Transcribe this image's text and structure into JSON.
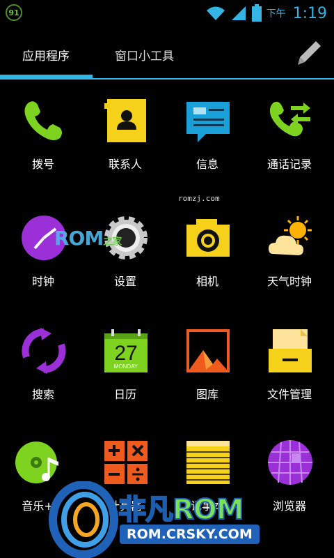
{
  "status_bar": {
    "badge": "91",
    "ampm": "下午",
    "time": "1:19",
    "icons": [
      "wifi-icon",
      "signal-icon",
      "battery-icon"
    ]
  },
  "tabs": {
    "apps": "应用程序",
    "widgets": "窗口小工具",
    "pencil_icon": "pencil-icon"
  },
  "apps": [
    {
      "label": "拨号",
      "icon": "phone-icon"
    },
    {
      "label": "联系人",
      "icon": "contacts-icon"
    },
    {
      "label": "信息",
      "icon": "message-icon"
    },
    {
      "label": "通话记录",
      "icon": "call-log-icon"
    },
    {
      "label": "时钟",
      "icon": "clock-icon"
    },
    {
      "label": "设置",
      "icon": "settings-gear-icon"
    },
    {
      "label": "相机",
      "icon": "camera-icon"
    },
    {
      "label": "天气时钟",
      "icon": "weather-icon"
    },
    {
      "label": "搜索",
      "icon": "search-refresh-icon"
    },
    {
      "label": "日历",
      "icon": "calendar-icon"
    },
    {
      "label": "图库",
      "icon": "gallery-icon"
    },
    {
      "label": "文件管理",
      "icon": "file-manager-icon"
    },
    {
      "label": "音乐+",
      "icon": "music-icon"
    },
    {
      "label": "计算器",
      "icon": "calculator-icon"
    },
    {
      "label": "记事本",
      "icon": "notepad-icon"
    },
    {
      "label": "浏览器",
      "icon": "browser-icon"
    }
  ],
  "calendar_icon": {
    "day": "27",
    "weekday": "MONDAY"
  },
  "watermarks": {
    "small_url": "romzj.com",
    "rom_logo": "ROM",
    "rom_logo_small": "之家",
    "bottom_title_a": "非凡",
    "bottom_title_b": "ROM",
    "bottom_url": "ROM.CRSKY.COM"
  },
  "colors": {
    "accent": "#33b5e5",
    "background": "#000000"
  }
}
